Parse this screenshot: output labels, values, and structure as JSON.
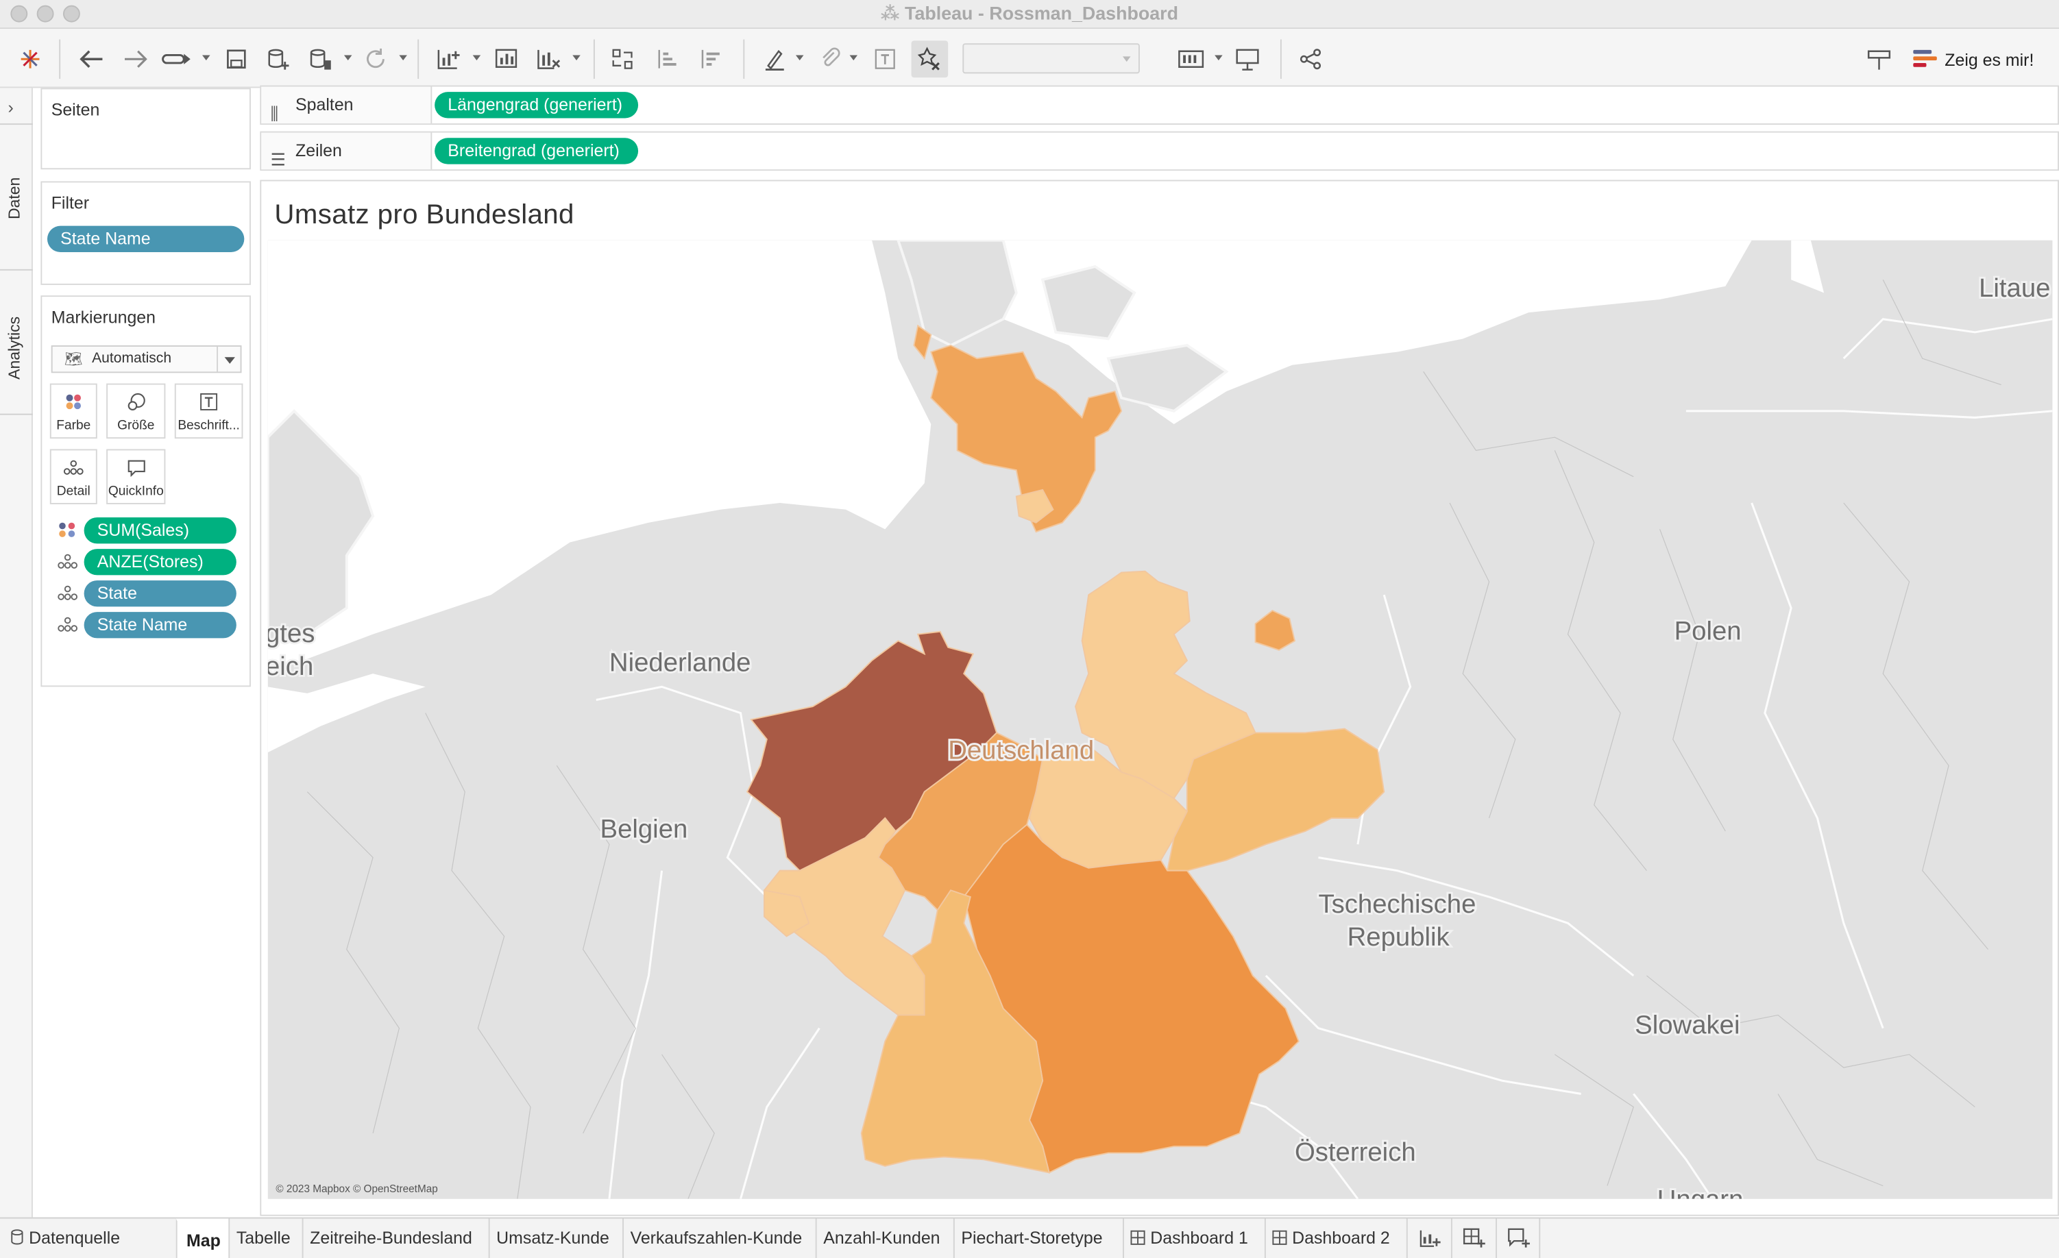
{
  "window": {
    "title": "Tableau - Rossman_Dashboard"
  },
  "toolbar": {
    "show_me_label": "Zeig es mir!",
    "icons": [
      "tableau-logo-icon",
      "undo-icon",
      "redo-icon",
      "replay-icon",
      "save-icon",
      "new-datasource-icon",
      "pause-updates-icon",
      "refresh-icon",
      "new-worksheet-icon",
      "duplicate-sheet-icon",
      "clear-sheet-icon",
      "swap-icon",
      "sort-ascending-icon",
      "sort-descending-icon",
      "highlight-icon",
      "group-icon",
      "show-labels-icon",
      "fix-axes-icon",
      "fit-icon",
      "presentation-icon",
      "share-icon",
      "pin-icon"
    ]
  },
  "side_tabs": {
    "data": "Daten",
    "analytics": "Analytics"
  },
  "pages_card": {
    "title": "Seiten"
  },
  "filter_card": {
    "title": "Filter",
    "pills": [
      "State Name"
    ]
  },
  "marks_card": {
    "title": "Markierungen",
    "mark_type": "Automatisch",
    "buttons": {
      "color": "Farbe",
      "size": "Größe",
      "label": "Beschrift...",
      "detail": "Detail",
      "tooltip": "QuickInfo"
    },
    "fields": [
      {
        "label": "SUM(Sales)",
        "kind": "measure",
        "encoding": "color"
      },
      {
        "label": "ANZE(Stores)",
        "kind": "measure",
        "encoding": "detail"
      },
      {
        "label": "State",
        "kind": "dimension",
        "encoding": "detail"
      },
      {
        "label": "State Name",
        "kind": "dimension",
        "encoding": "detail"
      }
    ]
  },
  "shelves": {
    "columns_label": "Spalten",
    "columns_pill": "Längengrad (generiert)",
    "rows_label": "Zeilen",
    "rows_pill": "Breitengrad (generiert)"
  },
  "viz": {
    "title": "Umsatz pro Bundesland",
    "attribution": "© 2023 Mapbox © OpenStreetMap",
    "map_labels": {
      "uk_part1": "gtes",
      "uk_part2": "eich",
      "nl": "Niederlande",
      "be": "Belgien",
      "de": "Deutschland",
      "pl": "Polen",
      "cz1": "Tschechische",
      "cz2": "Republik",
      "sk": "Slowakei",
      "at": "Österreich",
      "lt": "Litaue",
      "hu": "Ungarn"
    },
    "colors": {
      "darkest": "#a95a45",
      "dark": "#ee9445",
      "mid": "#f0a55a",
      "light": "#f4bd74",
      "lighter": "#f8cd95"
    }
  },
  "bottom_tabs": {
    "datasource": "Datenquelle",
    "sheets": [
      "Map",
      "Tabelle",
      "Zeitreihe-Bundesland",
      "Umsatz-Kunde",
      "Verkaufszahlen-Kunde",
      "Anzahl-Kunden",
      "Piechart-Storetype"
    ],
    "dashboards": [
      "Dashboard 1",
      "Dashboard 2"
    ],
    "active": "Map"
  }
}
